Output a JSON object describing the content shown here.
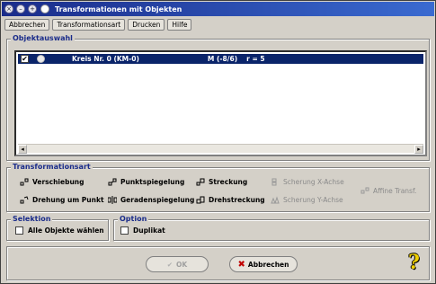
{
  "window": {
    "title": "Transformationen mit Objekten"
  },
  "menu": [
    {
      "label": "Abbrechen"
    },
    {
      "label": "Transformationsart"
    },
    {
      "label": "Drucken"
    },
    {
      "label": "Hilfe"
    }
  ],
  "objects": {
    "group_label": "Objektauswahl",
    "rows": [
      {
        "checked": "✔",
        "name": "Kreis Nr. 0  (KM-0)",
        "center": "M (-8/6)",
        "radius": "r = 5"
      }
    ]
  },
  "transform": {
    "group_label": "Transformationsart",
    "items": [
      {
        "label": "Verschiebung",
        "icon": "translate-icon",
        "enabled": true
      },
      {
        "label": "Punktspiegelung",
        "icon": "point-reflection-icon",
        "enabled": true
      },
      {
        "label": "Streckung",
        "icon": "scaling-icon",
        "enabled": true
      },
      {
        "label": "Scherung X-Achse",
        "icon": "shear-x-icon",
        "enabled": false
      },
      {
        "label": "Drehung um Punkt",
        "icon": "rotation-icon",
        "enabled": true
      },
      {
        "label": "Geradenspiegelung",
        "icon": "line-reflection-icon",
        "enabled": true
      },
      {
        "label": "Drehstreckung",
        "icon": "rotation-scaling-icon",
        "enabled": true
      },
      {
        "label": "Scherung Y-Achse",
        "icon": "shear-y-icon",
        "enabled": false
      },
      {
        "label": "Affine Transf.",
        "icon": "affine-icon",
        "enabled": false
      }
    ]
  },
  "selection": {
    "group_label": "Selektion",
    "all_objects_label": "Alle Objekte wählen"
  },
  "option": {
    "group_label": "Option",
    "duplicate_label": "Duplikat"
  },
  "buttons": {
    "ok": "OK",
    "cancel": "Abbrechen",
    "help": "?"
  }
}
